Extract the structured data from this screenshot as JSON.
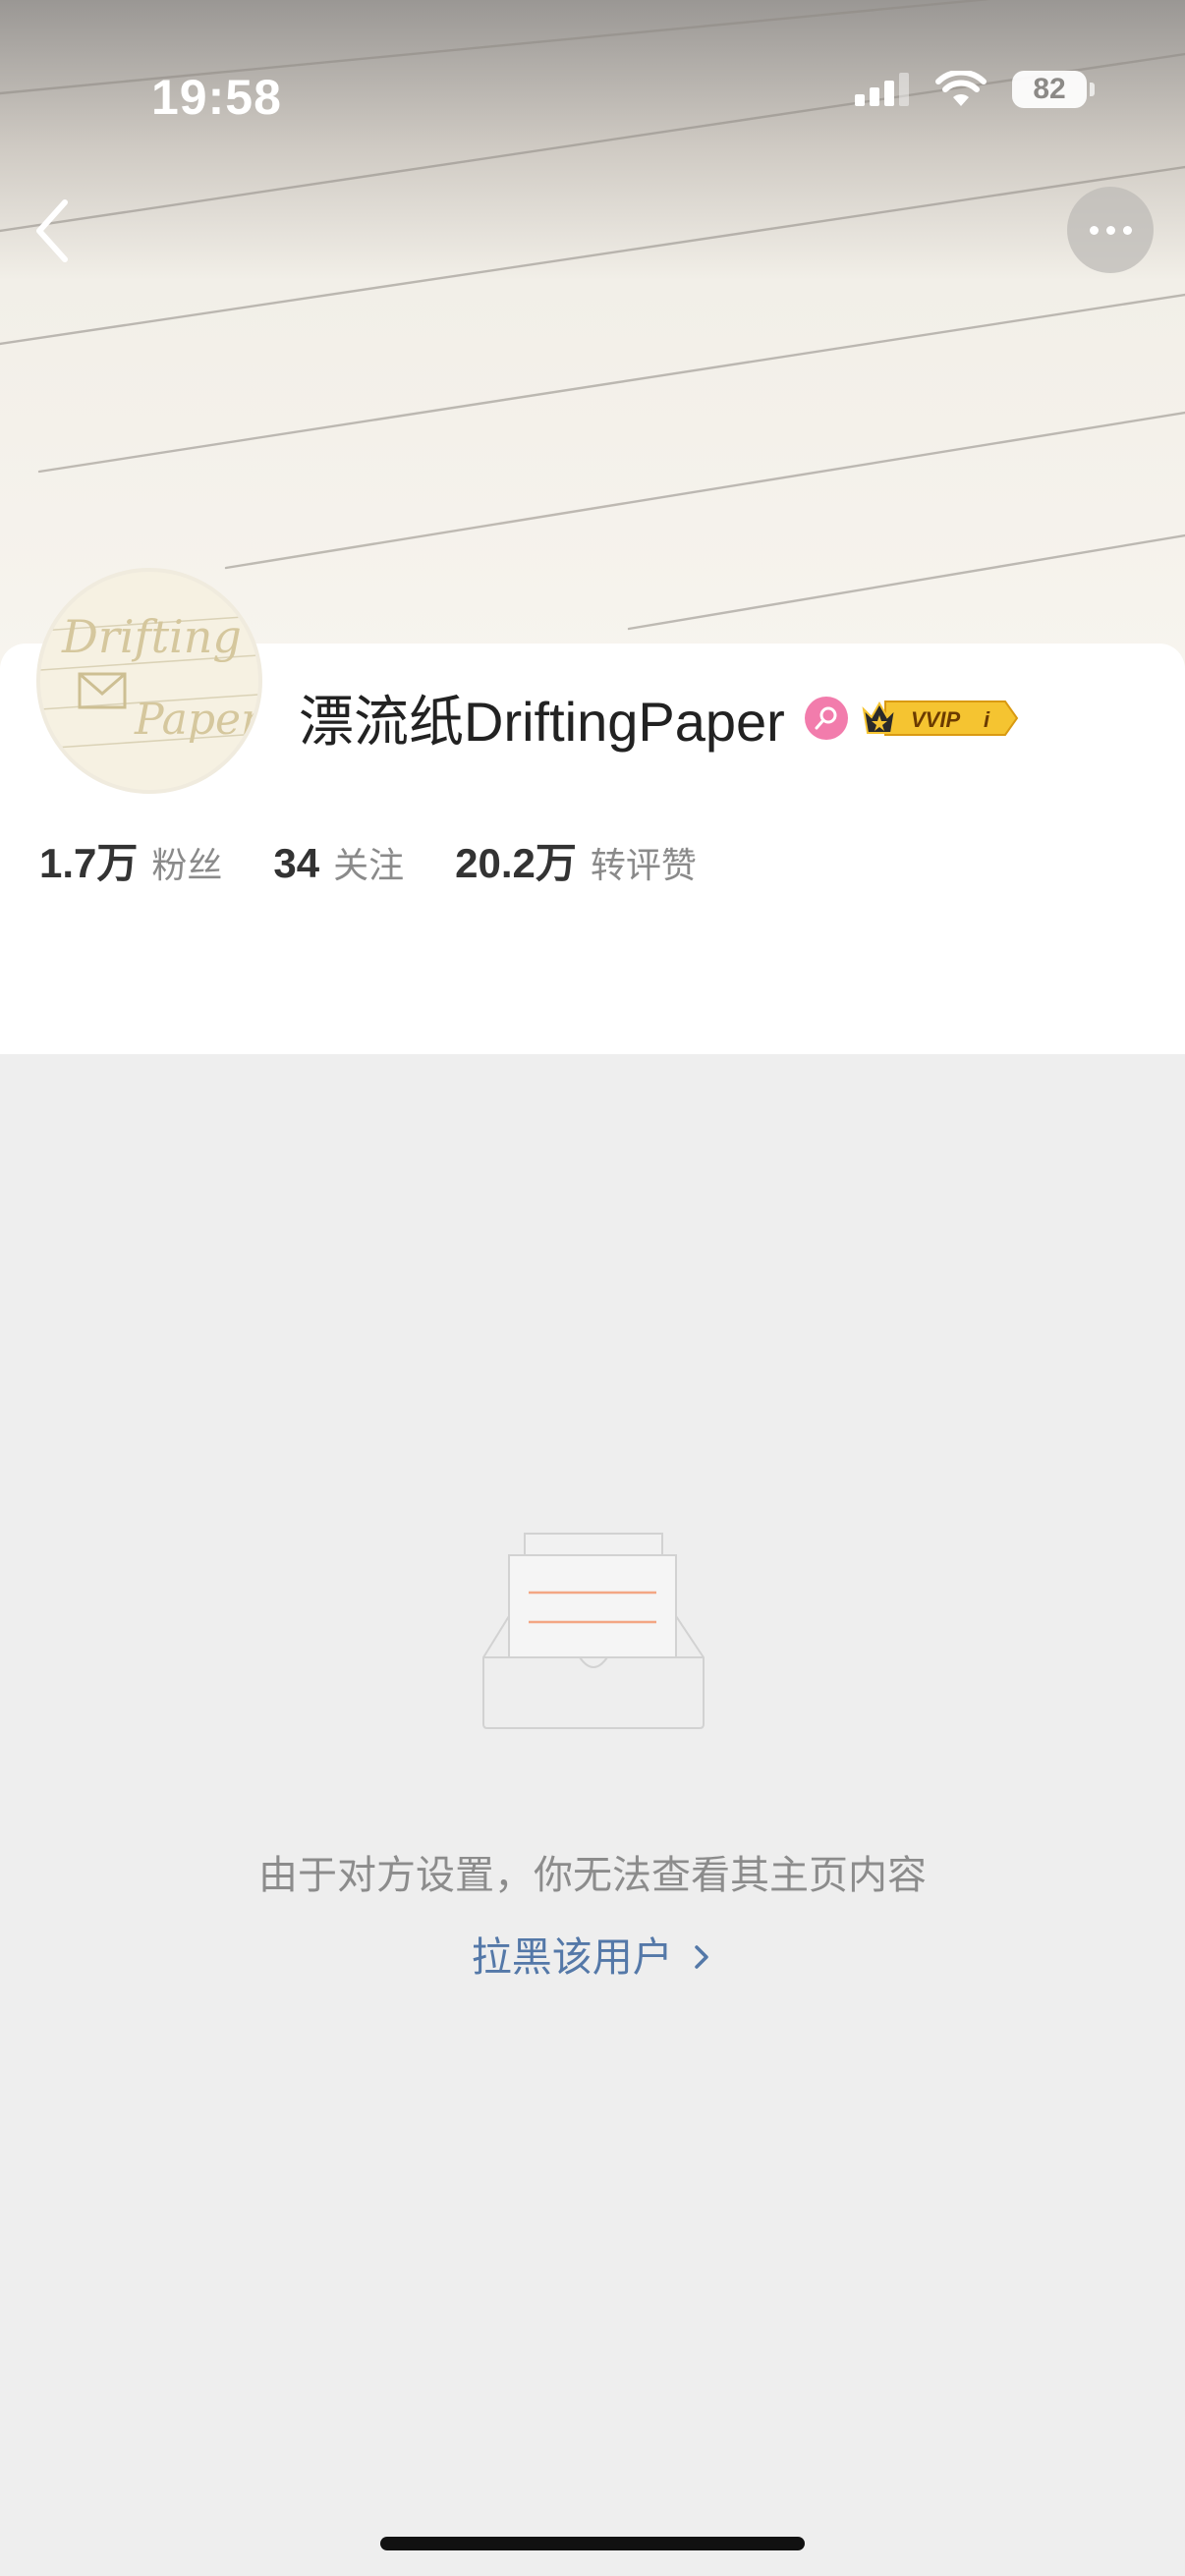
{
  "status_bar": {
    "time": "19:58",
    "battery": "82"
  },
  "header": {
    "back_icon": "chevron-left-icon",
    "more_icon": "ellipsis-icon"
  },
  "profile": {
    "name": "漂流纸DriftingPaper",
    "gender_badge": "female-icon",
    "vip_badge": "VVIP",
    "avatar_logo_text": "Drifting Paper"
  },
  "stats": [
    {
      "value": "1.7万",
      "label": "粉丝"
    },
    {
      "value": "34",
      "label": "关注"
    },
    {
      "value": "20.2万",
      "label": "转评赞"
    }
  ],
  "empty_state": {
    "message": "由于对方设置，你无法查看其主页内容",
    "action": "拉黑该用户",
    "action_icon": "chevron-right-icon"
  },
  "colors": {
    "link": "#5478a8",
    "page_bg": "#eeeeee",
    "gender_pink": "#f27cac",
    "vip_gold": "#f5c431"
  }
}
